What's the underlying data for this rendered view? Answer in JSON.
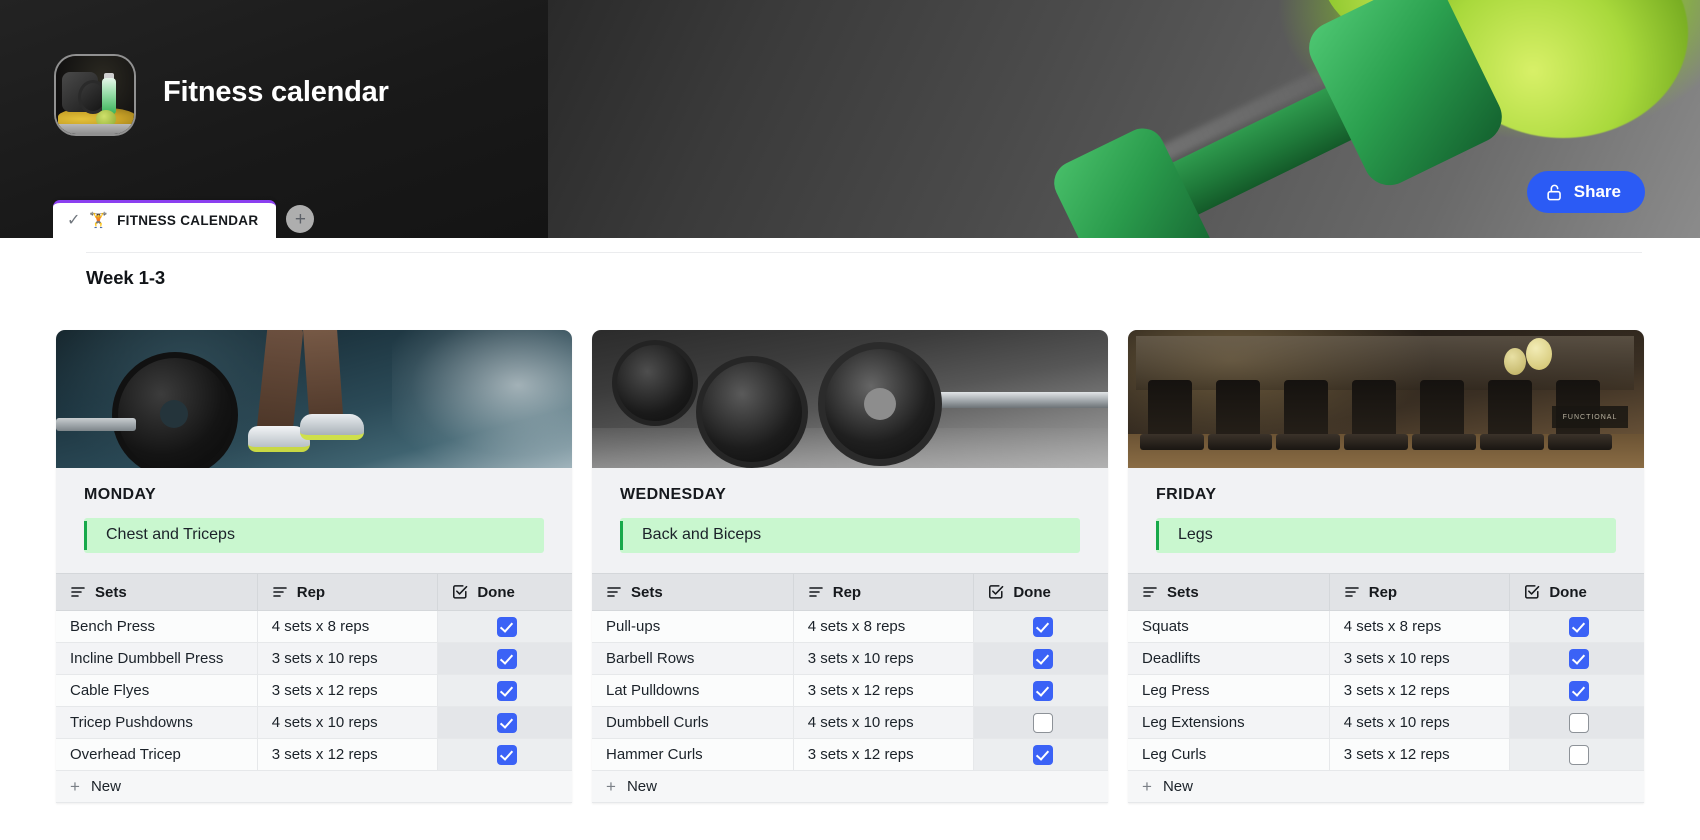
{
  "header": {
    "title": "Fitness calendar",
    "avatar_name": "fitness-avatar",
    "tab": {
      "check": "✓",
      "emoji": "🏋️",
      "label": "FITNESS CALENDAR"
    },
    "add_tab_label": "+",
    "share": {
      "label": "Share",
      "icon": "open-lock-icon",
      "color": "#2b5bf5"
    }
  },
  "board": {
    "section_title": "Week 1-3",
    "accent_green": "#c9f7cf",
    "accent_green_bar": "#17a94a",
    "checkbox_on_color": "#3b62f6",
    "columns": [
      "Sets",
      "Rep",
      "Done"
    ],
    "new_row_label": "New",
    "cards": [
      {
        "day": "MONDAY",
        "focus": "Chest and Triceps",
        "photo": "barbell-deadlift-photo",
        "rows": [
          {
            "set": "Bench Press",
            "rep": "4 sets x 8 reps",
            "done": true
          },
          {
            "set": "Incline Dumbbell Press",
            "rep": "3 sets x 10 reps",
            "done": true
          },
          {
            "set": "Cable Flyes",
            "rep": "3 sets x 12 reps",
            "done": true
          },
          {
            "set": "Tricep Pushdowns",
            "rep": "4 sets x 10 reps",
            "done": true
          },
          {
            "set": "Overhead Tricep",
            "rep": "3 sets x 12 reps",
            "done": true
          }
        ]
      },
      {
        "day": "WEDNESDAY",
        "focus": "Back and Biceps",
        "photo": "weight-plates-photo",
        "rows": [
          {
            "set": "Pull-ups",
            "rep": "4 sets x 8 reps",
            "done": true
          },
          {
            "set": "Barbell Rows",
            "rep": "3 sets x 10 reps",
            "done": true
          },
          {
            "set": "Lat Pulldowns",
            "rep": "3 sets x 12 reps",
            "done": true
          },
          {
            "set": "Dumbbell Curls",
            "rep": "4 sets x 10 reps",
            "done": false
          },
          {
            "set": "Hammer Curls",
            "rep": "3 sets x 12 reps",
            "done": true
          }
        ]
      },
      {
        "day": "FRIDAY",
        "focus": "Legs",
        "photo": "gym-cardio-room-photo",
        "rows": [
          {
            "set": "Squats",
            "rep": "4 sets x 8 reps",
            "done": true
          },
          {
            "set": "Deadlifts",
            "rep": "3 sets x 10 reps",
            "done": true
          },
          {
            "set": "Leg Press",
            "rep": "3 sets x 12 reps",
            "done": true
          },
          {
            "set": "Leg Extensions",
            "rep": "4 sets x 10 reps",
            "done": false
          },
          {
            "set": "Leg Curls",
            "rep": "3 sets x 12 reps",
            "done": false
          }
        ]
      }
    ]
  }
}
